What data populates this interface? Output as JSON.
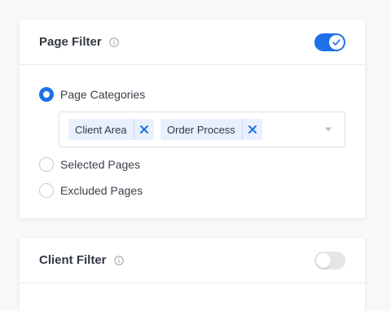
{
  "colors": {
    "accent": "#1e6fe8",
    "chip_bg": "#e8f0fd",
    "toggle_off": "#e4e6ea"
  },
  "page_filter": {
    "title": "Page Filter",
    "info_icon": "info-icon",
    "toggle": {
      "state": "on",
      "icon": "check-icon"
    },
    "options": [
      {
        "label": "Page Categories",
        "selected": true
      },
      {
        "label": "Selected Pages",
        "selected": false
      },
      {
        "label": "Excluded Pages",
        "selected": false
      }
    ],
    "select": {
      "chips": [
        {
          "label": "Client Area",
          "remove_icon": "close-icon"
        },
        {
          "label": "Order Process",
          "remove_icon": "close-icon"
        }
      ],
      "caret_icon": "chevron-down-icon"
    }
  },
  "client_filter": {
    "title": "Client Filter",
    "info_icon": "info-icon",
    "toggle": {
      "state": "off"
    }
  }
}
